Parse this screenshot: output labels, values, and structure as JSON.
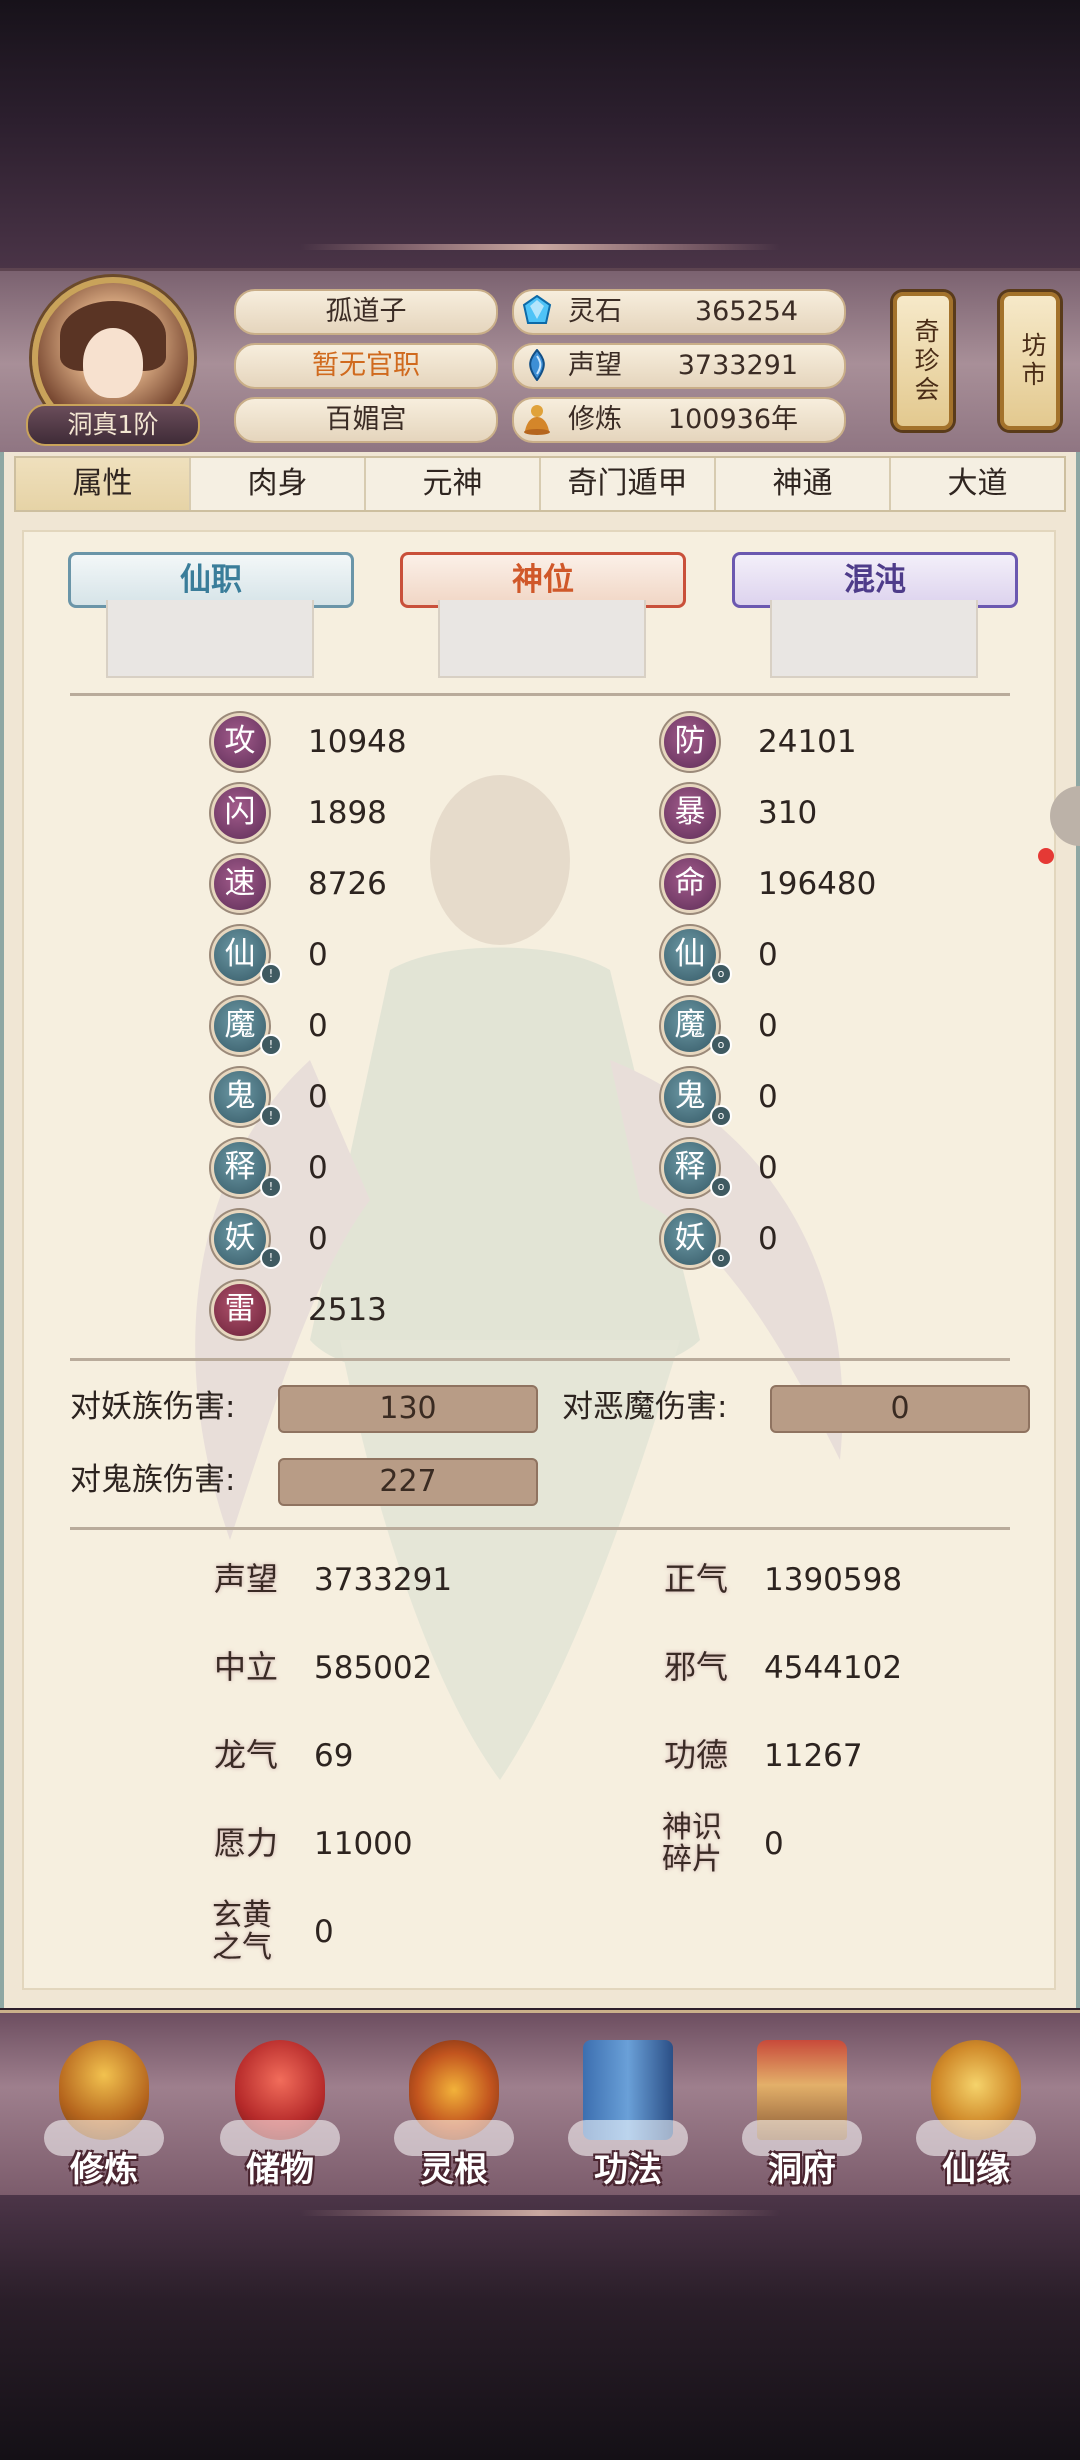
{
  "header": {
    "rank": "洞真1阶",
    "name": "孤道子",
    "office": "暂无官职",
    "sect": "百媚宫",
    "resources": [
      {
        "icon": "spirit-stone-icon",
        "label": "灵石",
        "value": "365254"
      },
      {
        "icon": "reputation-icon",
        "label": "声望",
        "value": "3733291"
      },
      {
        "icon": "cultivation-icon",
        "label": "修炼",
        "value": "100936年"
      }
    ],
    "treasure_button": "奇珍会",
    "market_button": "坊市"
  },
  "tabs": [
    "属性",
    "肉身",
    "元神",
    "奇门遁甲",
    "神通",
    "大道"
  ],
  "active_tab": "属性",
  "ranks": {
    "official": "仙职",
    "divine": "神位",
    "chaos": "混沌"
  },
  "stats_left": [
    {
      "glyph": "攻",
      "value": "10948"
    },
    {
      "glyph": "闪",
      "value": "1898"
    },
    {
      "glyph": "速",
      "value": "8726"
    },
    {
      "glyph": "仙",
      "value": "0"
    },
    {
      "glyph": "魔",
      "value": "0"
    },
    {
      "glyph": "鬼",
      "value": "0"
    },
    {
      "glyph": "释",
      "value": "0"
    },
    {
      "glyph": "妖",
      "value": "0"
    },
    {
      "glyph": "雷",
      "value": "2513"
    }
  ],
  "stats_right": [
    {
      "glyph": "防",
      "value": "24101"
    },
    {
      "glyph": "暴",
      "value": "310"
    },
    {
      "glyph": "命",
      "value": "196480"
    },
    {
      "glyph": "仙",
      "value": "0"
    },
    {
      "glyph": "魔",
      "value": "0"
    },
    {
      "glyph": "鬼",
      "value": "0"
    },
    {
      "glyph": "释",
      "value": "0"
    },
    {
      "glyph": "妖",
      "value": "0"
    }
  ],
  "damage": {
    "vs_demon_race_label": "对妖族伤害:",
    "vs_demon_race_value": "130",
    "vs_evil_demon_label": "对恶魔伤害:",
    "vs_evil_demon_value": "0",
    "vs_ghost_race_label": "对鬼族伤害:",
    "vs_ghost_race_value": "227"
  },
  "attributes": [
    {
      "label": "声望",
      "value": "3733291"
    },
    {
      "label": "正气",
      "value": "1390598"
    },
    {
      "label": "中立",
      "value": "585002"
    },
    {
      "label": "邪气",
      "value": "4544102"
    },
    {
      "label": "龙气",
      "value": "69"
    },
    {
      "label": "功德",
      "value": "11267"
    },
    {
      "label": "愿力",
      "value": "11000"
    },
    {
      "label": "神识碎片",
      "value": "0"
    },
    {
      "label": "玄黄之气",
      "value": "0"
    }
  ],
  "nav": [
    "修炼",
    "储物",
    "灵根",
    "功法",
    "洞府",
    "仙缘"
  ]
}
